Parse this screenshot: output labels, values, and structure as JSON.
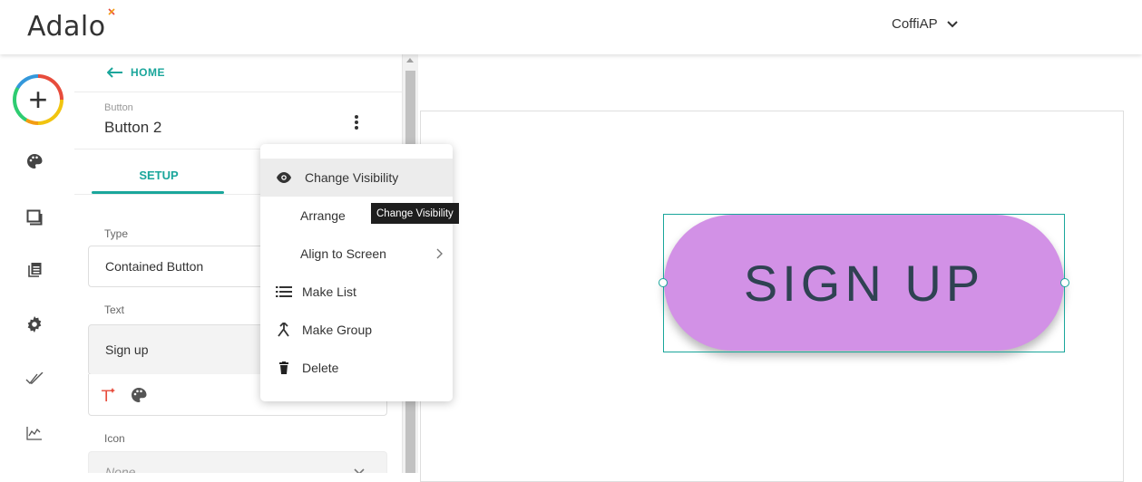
{
  "header": {
    "logo_text": "Adalo",
    "app_name": "CoffiAP"
  },
  "rail": {
    "icons": [
      "add-icon",
      "palette-icon",
      "screens-icon",
      "database-icon",
      "gear-icon",
      "publish-checks-icon",
      "analytics-icon"
    ]
  },
  "panel": {
    "back_label": "HOME",
    "component_type": "Button",
    "component_name": "Button 2",
    "tab_setup": "SETUP",
    "type_label": "Type",
    "type_value": "Contained Button",
    "text_label": "Text",
    "text_value": "Sign up",
    "icon_label": "Icon",
    "icon_value": "None"
  },
  "context_menu": {
    "items": [
      {
        "label": "Change Visibility",
        "icon": "eye-icon"
      },
      {
        "label": "Arrange",
        "icon": ""
      },
      {
        "label": "Align to Screen",
        "icon": ""
      },
      {
        "label": "Make List",
        "icon": "list-icon"
      },
      {
        "label": "Make Group",
        "icon": "merge-icon"
      },
      {
        "label": "Delete",
        "icon": "trash-icon"
      }
    ],
    "tooltip": "Change Visibility"
  },
  "canvas": {
    "button_text": "SIGN UP",
    "button_color": "#d291e6",
    "button_text_color": "#2f4252"
  },
  "colors": {
    "accent": "#1aa69b"
  }
}
